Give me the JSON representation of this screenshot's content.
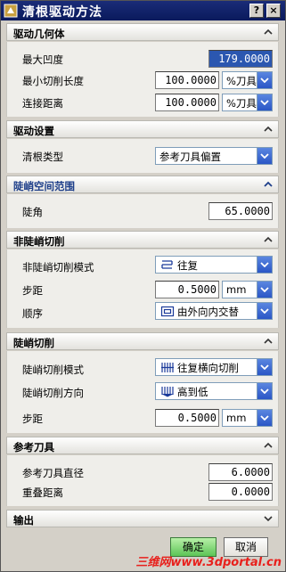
{
  "window": {
    "title": "清根驱动方法",
    "help_btn": "?",
    "close_btn": "×"
  },
  "sections": {
    "geometry": {
      "title": "驱动几何体",
      "max_concavity_label": "最大凹度",
      "max_concavity_value": "179.0000",
      "min_cut_length_label": "最小切削长度",
      "min_cut_length_value": "100.0000",
      "min_cut_length_unit": "%刀具",
      "connect_dist_label": "连接距离",
      "connect_dist_value": "100.0000",
      "connect_dist_unit": "%刀具"
    },
    "drive_settings": {
      "title": "驱动设置",
      "type_label": "清根类型",
      "type_value": "参考刀具偏置"
    },
    "steep_range": {
      "title": "陡峭空间范围",
      "angle_label": "陡角",
      "angle_value": "65.0000"
    },
    "non_steep": {
      "title": "非陡峭切削",
      "mode_label": "非陡峭切削模式",
      "mode_value": "往复",
      "stepover_label": "步距",
      "stepover_value": "0.5000",
      "stepover_unit": "mm",
      "order_label": "顺序",
      "order_value": "由外向内交替"
    },
    "steep": {
      "title": "陡峭切削",
      "mode_label": "陡峭切削模式",
      "mode_value": "往复横向切削",
      "direction_label": "陡峭切削方向",
      "direction_value": "高到低",
      "stepover_label": "步距",
      "stepover_value": "0.5000",
      "stepover_unit": "mm"
    },
    "ref_tool": {
      "title": "参考刀具",
      "diameter_label": "参考刀具直径",
      "diameter_value": "6.0000",
      "overlap_label": "重叠距离",
      "overlap_value": "0.0000"
    },
    "output": {
      "title": "输出"
    }
  },
  "footer": {
    "ok_label": "确定",
    "cancel_label": "取消",
    "watermark": "三维网www.3dportal.cn"
  },
  "colors": {
    "title_bar": "#0a1a5c",
    "active_section": "#1e3f8a",
    "ok_button": "#5cc456",
    "dropdown_button": "#2a56c6",
    "watermark": "#e8201c"
  }
}
